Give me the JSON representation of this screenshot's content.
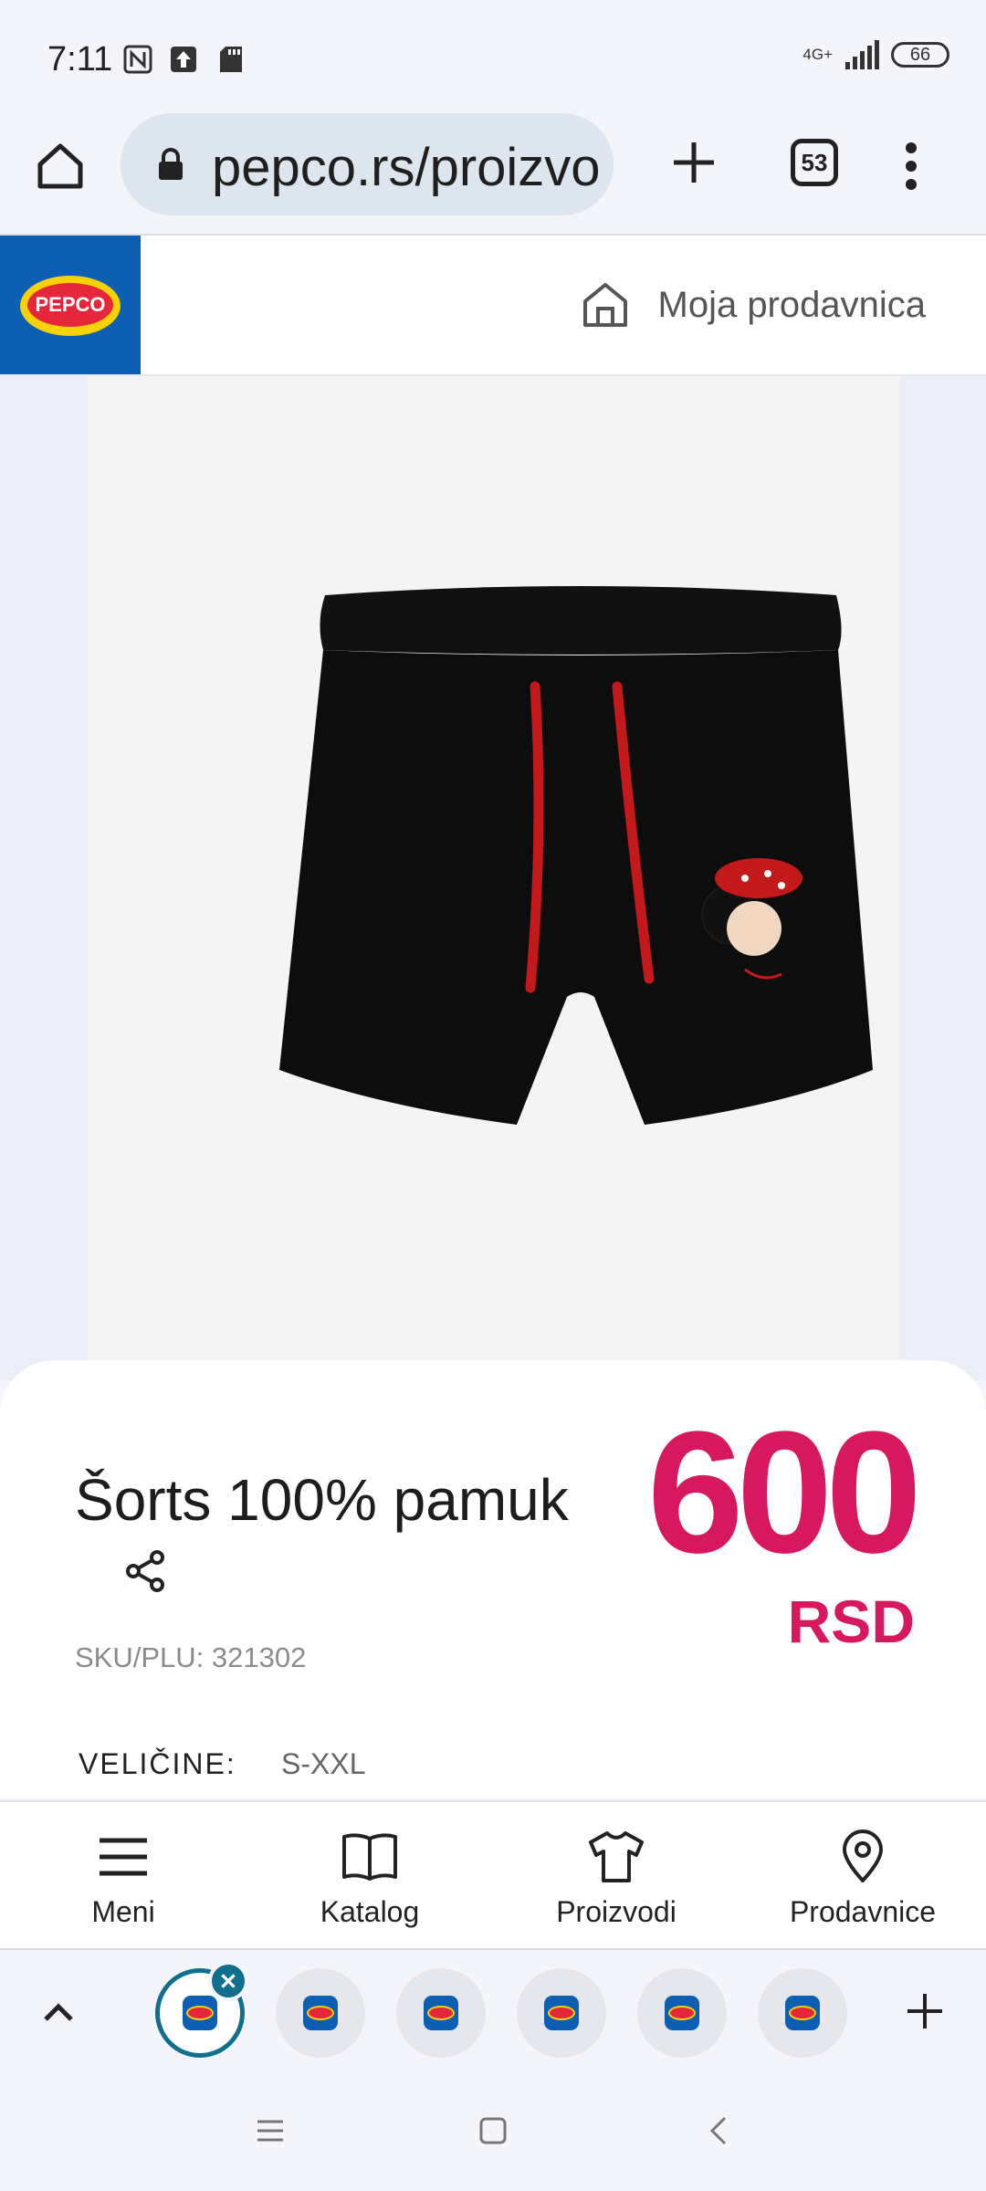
{
  "status_bar": {
    "time": "7:11",
    "network": "4G+",
    "battery": "66",
    "icons": [
      "nfc-icon",
      "upload-icon",
      "sd-card-icon",
      "signal-icon",
      "battery-icon"
    ]
  },
  "browser": {
    "url": "pepco.rs/proizvo",
    "tab_count": "53",
    "icons": [
      "home-icon",
      "lock-icon",
      "new-tab-icon",
      "tabs-icon",
      "more-menu-icon"
    ]
  },
  "site_header": {
    "logo_text": "PEPCO",
    "store_link": "Moja prodavnica"
  },
  "product": {
    "title": "Šorts 100% pamuk",
    "sku": "SKU/PLU: 321302",
    "price": "600",
    "currency": "RSD",
    "sizes_label": "VELIČINE:",
    "sizes_value": "S-XXL"
  },
  "site_nav": {
    "items": [
      {
        "label": "Meni",
        "icon": "hamburger-icon"
      },
      {
        "label": "Katalog",
        "icon": "book-icon"
      },
      {
        "label": "Proizvodi",
        "icon": "tshirt-icon"
      },
      {
        "label": "Prodavnice",
        "icon": "location-pin-icon"
      }
    ]
  },
  "tab_strip": {
    "tab_count_visible": 6
  },
  "colors": {
    "brand_blue": "#0d5fb3",
    "price_pink": "#d8185e",
    "active_tab": "#0f6f8c"
  }
}
